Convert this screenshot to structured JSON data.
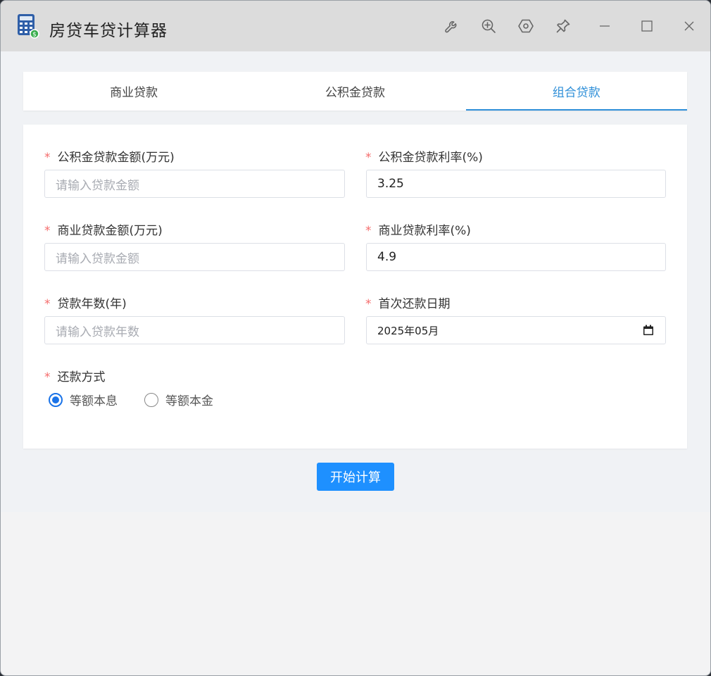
{
  "window": {
    "title": "房贷车贷计算器"
  },
  "tabs": [
    {
      "label": "商业贷款",
      "active": false
    },
    {
      "label": "公积金贷款",
      "active": false
    },
    {
      "label": "组合贷款",
      "active": true
    }
  ],
  "form": {
    "fund_amount": {
      "label": "公积金贷款金额(万元)",
      "placeholder": "请输入贷款金额",
      "value": ""
    },
    "fund_rate": {
      "label": "公积金贷款利率(%)",
      "value": "3.25"
    },
    "commercial_amount": {
      "label": "商业贷款金额(万元)",
      "placeholder": "请输入贷款金额",
      "value": ""
    },
    "commercial_rate": {
      "label": "商业贷款利率(%)",
      "value": "4.9"
    },
    "years": {
      "label": "贷款年数(年)",
      "placeholder": "请输入贷款年数",
      "value": ""
    },
    "first_payment_date": {
      "label": "首次还款日期",
      "value": "2025年05月"
    },
    "repayment_method": {
      "label": "还款方式",
      "options": [
        {
          "label": "等额本息",
          "checked": true
        },
        {
          "label": "等额本金",
          "checked": false
        }
      ]
    }
  },
  "actions": {
    "calculate_label": "开始计算"
  },
  "colors": {
    "accent": "#2f8fd8",
    "button": "#1e90ff",
    "required": "#f56c6c",
    "radio": "#1a73e8"
  }
}
